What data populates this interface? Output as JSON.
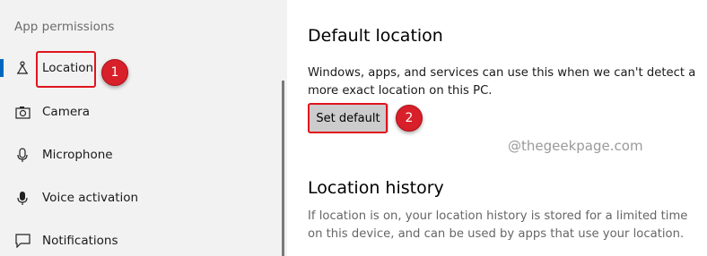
{
  "sidebar": {
    "heading": "App permissions",
    "items": [
      {
        "label": "Location",
        "icon": "location-icon",
        "selected": true
      },
      {
        "label": "Camera",
        "icon": "camera-icon"
      },
      {
        "label": "Microphone",
        "icon": "microphone-icon"
      },
      {
        "label": "Voice activation",
        "icon": "voice-activation-icon"
      },
      {
        "label": "Notifications",
        "icon": "notifications-icon"
      }
    ]
  },
  "main": {
    "default_location": {
      "title": "Default location",
      "description": "Windows, apps, and services can use this when we can't detect a more exact location on this PC.",
      "button_label": "Set default"
    },
    "location_history": {
      "title": "Location history",
      "description": "If location is on, your location history is stored for a limited time on this device, and can be used by apps that use your location."
    }
  },
  "annotations": {
    "step1": "1",
    "step2": "2"
  },
  "watermark": "@thegeekpage.com",
  "colors": {
    "accent": "#0067c0",
    "callout_red": "#d8202a",
    "sidebar_bg": "#f2f2f2",
    "button_bg": "#cccccc"
  }
}
